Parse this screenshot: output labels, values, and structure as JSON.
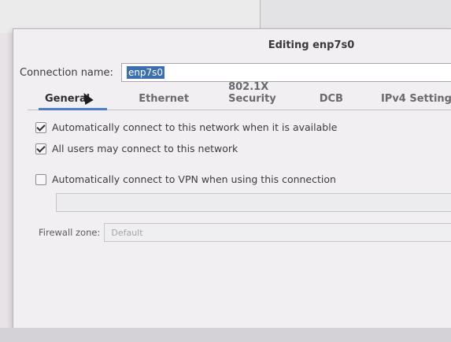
{
  "dialog": {
    "title": "Editing enp7s0",
    "connection_name_label": "Connection name:",
    "connection_name_value": "enp7s0"
  },
  "tabs": [
    {
      "label": "General",
      "active": true
    },
    {
      "label": "Ethernet",
      "active": false
    },
    {
      "label": "802.1X Security",
      "active": false
    },
    {
      "label": "DCB",
      "active": false
    },
    {
      "label": "IPv4 Setting",
      "active": false
    }
  ],
  "general": {
    "auto_connect_label": "Automatically connect to this network when it is available",
    "auto_connect_checked": true,
    "all_users_label": "All users may connect to this network",
    "all_users_checked": true,
    "auto_vpn_label": "Automatically connect to VPN when using this connection",
    "auto_vpn_checked": false,
    "firewall_zone_label": "Firewall zone:",
    "firewall_zone_value": "Default"
  },
  "colors": {
    "accent": "#4a7ecb",
    "selection": "#3b6fb0"
  }
}
